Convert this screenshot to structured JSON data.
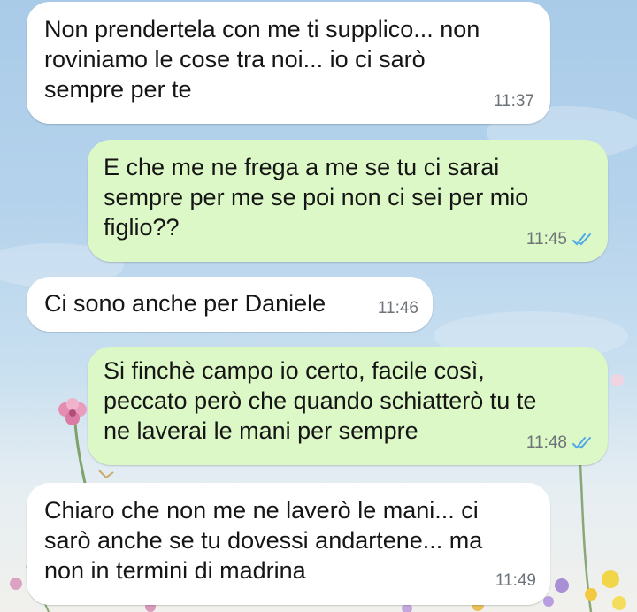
{
  "chat": {
    "messages": [
      {
        "direction": "incoming",
        "text": "Non prendertela con me ti supplico... non\nroviniamo le cose tra noi... io ci sarò\nsempre per te",
        "time": "11:37"
      },
      {
        "direction": "outgoing",
        "text": "E che me ne frega a me se tu ci sarai\nsempre per me se poi non ci sei per mio\nfiglio??",
        "time": "11:45",
        "status": "read-double-check-icon"
      },
      {
        "direction": "incoming",
        "text": "Ci sono anche per Daniele",
        "time": "11:46"
      },
      {
        "direction": "outgoing",
        "text": "Si finchè campo io certo, facile così,\npeccato però che quando schiatterò tu te\nne laverai le mani per sempre",
        "time": "11:48",
        "status": "read-double-check-icon"
      },
      {
        "direction": "incoming",
        "text": "Chiaro che non me ne laverò le mani... ci\nsarò anche se tu dovessi andartene... ma\nnon in termini di madrina",
        "time": "11:49"
      }
    ]
  },
  "colors": {
    "incoming_bubble": "#ffffff",
    "outgoing_bubble": "#dcf8c6",
    "read_ticks": "#4fa9e8",
    "timestamp": "#6c7379"
  }
}
